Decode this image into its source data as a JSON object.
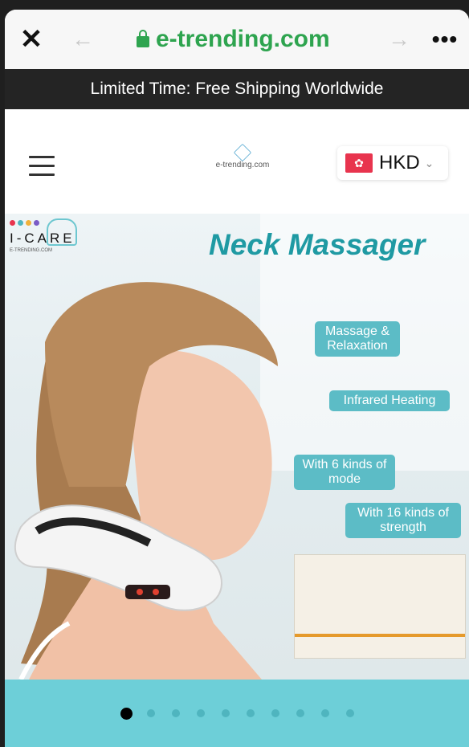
{
  "browser": {
    "close_glyph": "✕",
    "back_glyph": "←",
    "forward_glyph": "→",
    "more_glyph": "•••",
    "url": "e-trending.com"
  },
  "announcement": "Limited Time: Free Shipping Worldwide",
  "header": {
    "logo_text": "e-trending.com",
    "currency": "HKD",
    "flag_icon": "hk-flag-icon",
    "flag_glyph": "✿"
  },
  "hero": {
    "brand_name": "I-CARE",
    "brand_sub": "E-TRENDING.COM",
    "title": "Neck Massager",
    "tags": [
      "Massage & Relaxation",
      "Infrared Heating",
      "With 6 kinds of mode",
      "With 16 kinds of strength"
    ]
  },
  "carousel": {
    "total_slides": 10,
    "active_index": 0
  },
  "colors": {
    "accent_teal": "#1f9aa3",
    "carousel_bg": "#6dcfd8",
    "secure_green": "#2ea44f"
  }
}
